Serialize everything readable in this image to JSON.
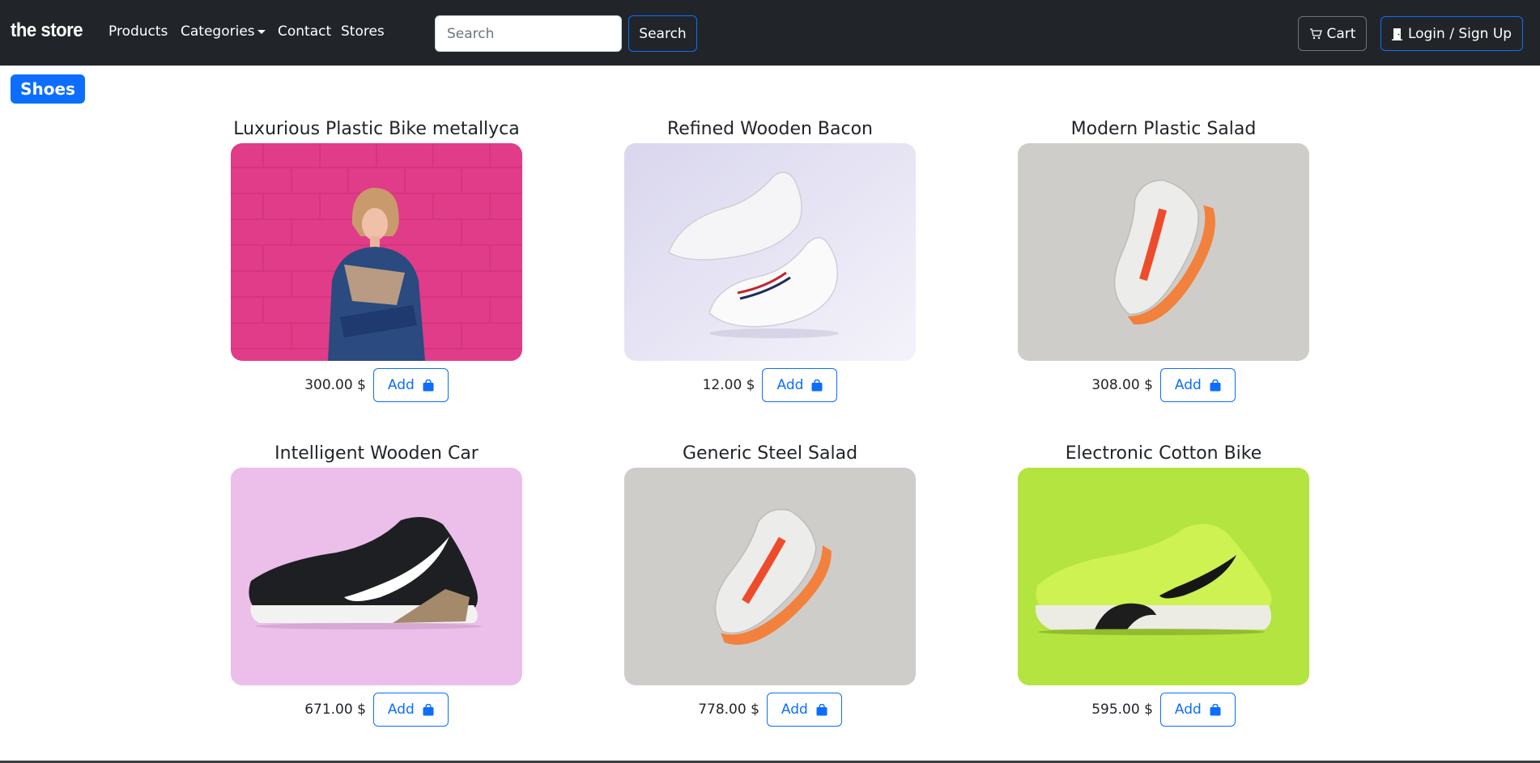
{
  "navbar": {
    "brand": "the store",
    "links": [
      {
        "label": "Products"
      },
      {
        "label": "Categories"
      },
      {
        "label": "Contact"
      },
      {
        "label": "Stores"
      }
    ],
    "search": {
      "placeholder": "Search",
      "value": "",
      "button_label": "Search"
    },
    "cart_label": "Cart",
    "login_label": "Login / Sign Up",
    "icons": {
      "cart": "cart-icon",
      "login": "door-icon",
      "categories": "caret-down-icon"
    }
  },
  "category": {
    "label": "Shoes"
  },
  "products": [
    {
      "name": "Luxurious Plastic Bike metallyca",
      "price": "300.00 $",
      "add_label": "Add",
      "image": "woman-pink-wall",
      "bg": "#e23a8a"
    },
    {
      "name": "Refined Wooden Bacon",
      "price": "12.00 $",
      "add_label": "Add",
      "image": "white-sneakers-pair",
      "bg": "#e7e5f3"
    },
    {
      "name": "Modern Plastic Salad",
      "price": "308.00 $",
      "add_label": "Add",
      "image": "orange-white-sneaker",
      "bg": "#cfcdca"
    },
    {
      "name": "Intelligent Wooden Car",
      "price": "671.00 $",
      "add_label": "Add",
      "image": "black-sneaker-pink-bg",
      "bg": "#ebbfe9"
    },
    {
      "name": "Generic Steel Salad",
      "price": "778.00 $",
      "add_label": "Add",
      "image": "orange-white-sneaker",
      "bg": "#cfcdca"
    },
    {
      "name": "Electronic Cotton Bike",
      "price": "595.00 $",
      "add_label": "Add",
      "image": "lime-sneaker",
      "bg": "#b3e43f"
    }
  ],
  "colors": {
    "navbar": "#212529",
    "accent": "#0d6efd",
    "text": "#212529"
  }
}
